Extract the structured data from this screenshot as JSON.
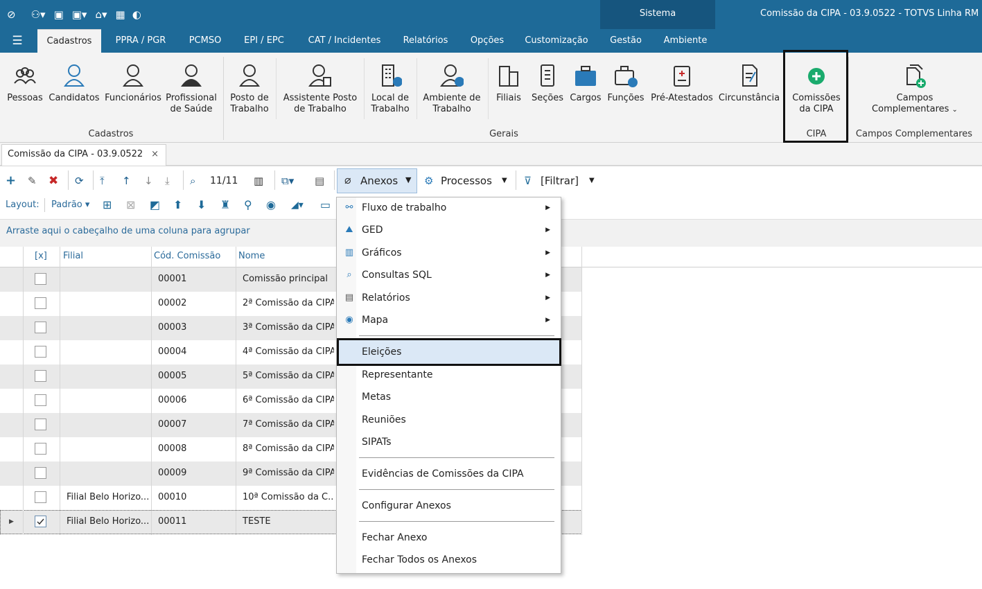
{
  "window": {
    "title": "Comissão da CIPA - 03.9.0522 - TOTVS Linha RM -",
    "system_label": "Sistema"
  },
  "ribbon_tabs": [
    "Cadastros",
    "PPRA / PGR",
    "PCMSO",
    "EPI / EPC",
    "CAT / Incidentes",
    "Relatórios",
    "Opções",
    "Customização",
    "Gestão",
    "Ambiente"
  ],
  "ribbon": {
    "buttons": {
      "pessoas": "Pessoas",
      "candidatos": "Candidatos",
      "funcionarios": "Funcionários",
      "profissional_l1": "Profissional",
      "profissional_l2": "de Saúde",
      "posto_l1": "Posto de",
      "posto_l2": "Trabalho",
      "assistente_l1": "Assistente Posto",
      "assistente_l2": "de Trabalho",
      "local_l1": "Local de",
      "local_l2": "Trabalho",
      "ambiente_l1": "Ambiente de",
      "ambiente_l2": "Trabalho",
      "filiais": "Filiais",
      "secoes": "Seções",
      "cargos": "Cargos",
      "funcoes": "Funções",
      "pre_atestados": "Pré-Atestados",
      "circunstancia": "Circunstância",
      "comissoes_l1": "Comissões",
      "comissoes_l2": "da CIPA",
      "campos_l1": "Campos",
      "campos_l2": "Complementares"
    },
    "groups": {
      "cadastros": "Cadastros",
      "gerais": "Gerais",
      "cipa": "CIPA",
      "campos": "Campos Complementares"
    }
  },
  "doc_tab": {
    "label": "Comissão da CIPA - 03.9.0522",
    "close": "×"
  },
  "toolbar": {
    "counter": "11/11",
    "anexos": "Anexos",
    "processos": "Processos",
    "filtrar": "[Filtrar]",
    "layout_label": "Layout:",
    "layout_value": "Padrão"
  },
  "group_hint": "Arraste aqui o cabeçalho de uma coluna para agrupar",
  "grid": {
    "headers": {
      "check": "[x]",
      "filial": "Filial",
      "cod": "Cód. Comissão",
      "nome": "Nome"
    },
    "rows": [
      {
        "filial": "",
        "cod": "00001",
        "nome": "Comissão principal",
        "checked": false
      },
      {
        "filial": "",
        "cod": "00002",
        "nome": "2ª Comissão da CIPA",
        "checked": false
      },
      {
        "filial": "",
        "cod": "00003",
        "nome": "3ª Comissão da CIPA",
        "checked": false
      },
      {
        "filial": "",
        "cod": "00004",
        "nome": "4ª Comissão da CIPA",
        "checked": false
      },
      {
        "filial": "",
        "cod": "00005",
        "nome": "5ª Comissão da CIPA",
        "checked": false
      },
      {
        "filial": "",
        "cod": "00006",
        "nome": "6ª Comissão da CIPA",
        "checked": false
      },
      {
        "filial": "",
        "cod": "00007",
        "nome": "7ª Comissão da CIPA",
        "checked": false
      },
      {
        "filial": "",
        "cod": "00008",
        "nome": "8ª Comissão da CIPA",
        "checked": false
      },
      {
        "filial": "",
        "cod": "00009",
        "nome": "9ª Comissão da CIPA",
        "checked": false
      },
      {
        "filial": "Filial Belo Horizo...",
        "cod": "00010",
        "nome": "10ª Comissão da C...",
        "checked": false
      },
      {
        "filial": "Filial Belo Horizo...",
        "cod": "00011",
        "nome": "TESTE",
        "checked": true
      }
    ]
  },
  "menu": {
    "fluxo": "Fluxo de trabalho",
    "ged": "GED",
    "graficos": "Gráficos",
    "consultas": "Consultas SQL",
    "relatorios": "Relatórios",
    "mapa": "Mapa",
    "eleicoes": "Eleições",
    "representante": "Representante",
    "metas": "Metas",
    "reunioes": "Reuniões",
    "sipats": "SIPATs",
    "evidencias": "Evidências de Comissões da CIPA",
    "configurar": "Configurar Anexos",
    "fechar": "Fechar Anexo",
    "fechar_todos": "Fechar Todos os Anexos"
  },
  "colors": {
    "brand": "#1e6a98",
    "brand_dark": "#16557e",
    "accent_green": "#1aab6d",
    "highlight": "#dbe8f6"
  }
}
